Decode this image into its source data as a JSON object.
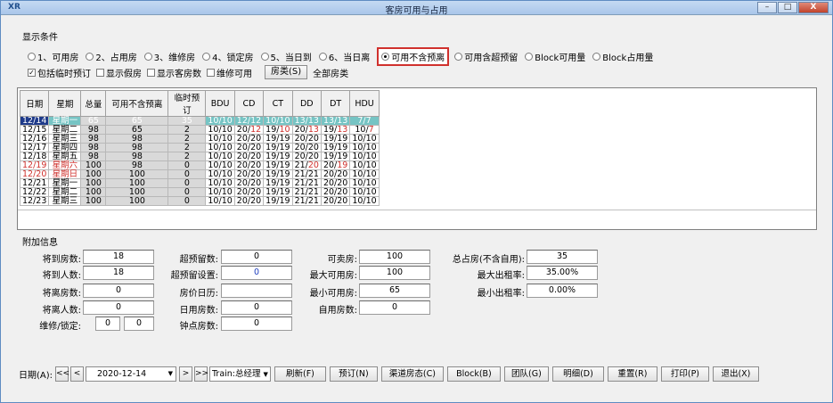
{
  "window": {
    "title": "客房可用与占用",
    "app_icon": "XR",
    "minimize": "–",
    "maximize": "□",
    "close": "X"
  },
  "display": {
    "group_label": "显示条件",
    "radios": [
      {
        "label": "1、可用房",
        "selected": false
      },
      {
        "label": "2、占用房",
        "selected": false
      },
      {
        "label": "3、维修房",
        "selected": false
      },
      {
        "label": "4、锁定房",
        "selected": false
      },
      {
        "label": "5、当日到",
        "selected": false
      },
      {
        "label": "6、当日离",
        "selected": false
      },
      {
        "label": "可用不含预离",
        "selected": true
      },
      {
        "label": "可用含超预留",
        "selected": false
      },
      {
        "label": "Block可用量",
        "selected": false
      },
      {
        "label": "Block占用量",
        "selected": false
      }
    ],
    "checks": [
      {
        "label": "包括临时预订",
        "checked": true
      },
      {
        "label": "显示假房",
        "checked": false
      },
      {
        "label": "显示客房数",
        "checked": false
      },
      {
        "label": "维修可用",
        "checked": false
      }
    ],
    "room_type_button": "房类(S)",
    "room_type_value": "全部房类"
  },
  "grid": {
    "headers": [
      "日期",
      "星期",
      "总量",
      "可用不含预离",
      "临时预订",
      "BDU",
      "CD",
      "CT",
      "DD",
      "DT",
      "HDU"
    ],
    "rows": [
      {
        "date": "12/14",
        "weekday": "星期一",
        "total": "65",
        "avail": "65",
        "temp": "35",
        "bdu": "10/10",
        "cd": "12/12",
        "ct": "10/10",
        "dd": "13/13",
        "dt": "13/13",
        "hdu": "7/7"
      },
      {
        "date": "12/15",
        "weekday": "星期二",
        "total": "98",
        "avail": "65",
        "temp": "2",
        "bdu": "10/10",
        "cd": "20/12",
        "ct": "19/10",
        "dd": "20/13",
        "dt": "19/13",
        "hdu": "10/7"
      },
      {
        "date": "12/16",
        "weekday": "星期三",
        "total": "98",
        "avail": "98",
        "temp": "2",
        "bdu": "10/10",
        "cd": "20/20",
        "ct": "19/19",
        "dd": "20/20",
        "dt": "19/19",
        "hdu": "10/10"
      },
      {
        "date": "12/17",
        "weekday": "星期四",
        "total": "98",
        "avail": "98",
        "temp": "2",
        "bdu": "10/10",
        "cd": "20/20",
        "ct": "19/19",
        "dd": "20/20",
        "dt": "19/19",
        "hdu": "10/10"
      },
      {
        "date": "12/18",
        "weekday": "星期五",
        "total": "98",
        "avail": "98",
        "temp": "2",
        "bdu": "10/10",
        "cd": "20/20",
        "ct": "19/19",
        "dd": "20/20",
        "dt": "19/19",
        "hdu": "10/10"
      },
      {
        "date": "12/19",
        "weekday": "星期六",
        "total": "100",
        "avail": "98",
        "temp": "0",
        "bdu": "10/10",
        "cd": "20/20",
        "ct": "19/19",
        "dd": "21/20",
        "dt": "20/19",
        "hdu": "10/10"
      },
      {
        "date": "12/20",
        "weekday": "星期日",
        "total": "100",
        "avail": "100",
        "temp": "0",
        "bdu": "10/10",
        "cd": "20/20",
        "ct": "19/19",
        "dd": "21/21",
        "dt": "20/20",
        "hdu": "10/10"
      },
      {
        "date": "12/21",
        "weekday": "星期一",
        "total": "100",
        "avail": "100",
        "temp": "0",
        "bdu": "10/10",
        "cd": "20/20",
        "ct": "19/19",
        "dd": "21/21",
        "dt": "20/20",
        "hdu": "10/10"
      },
      {
        "date": "12/22",
        "weekday": "星期二",
        "total": "100",
        "avail": "100",
        "temp": "0",
        "bdu": "10/10",
        "cd": "20/20",
        "ct": "19/19",
        "dd": "21/21",
        "dt": "20/20",
        "hdu": "10/10"
      },
      {
        "date": "12/23",
        "weekday": "星期三",
        "total": "100",
        "avail": "100",
        "temp": "0",
        "bdu": "10/10",
        "cd": "20/20",
        "ct": "19/19",
        "dd": "21/21",
        "dt": "20/20",
        "hdu": "10/10"
      }
    ]
  },
  "info": {
    "title": "附加信息",
    "arr_rooms_label": "将到房数:",
    "arr_rooms": "18",
    "arr_people_label": "将到人数:",
    "arr_people": "18",
    "dep_rooms_label": "将离房数:",
    "dep_rooms": "0",
    "dep_people_label": "将离人数:",
    "dep_people": "0",
    "maint_lock_label": "维修/锁定:",
    "maint": "0",
    "lock": "0",
    "over_reserve_label": "超预留数:",
    "over_reserve": "0",
    "over_setting_label": "超预留设置:",
    "over_setting": "0",
    "price_calendar_label": "房价日历:",
    "price_calendar": "",
    "day_use_label": "日用房数:",
    "day_use": "0",
    "hourly_label": "钟点房数:",
    "hourly": "0",
    "sellable_label": "可卖房:",
    "sellable": "100",
    "max_avail_label": "最大可用房:",
    "max_avail": "100",
    "min_avail_label": "最小可用房:",
    "min_avail": "65",
    "self_use_label": "自用房数:",
    "self_use": "0",
    "total_occ_label": "总占房(不含自用):",
    "total_occ": "35",
    "max_rate_label": "最大出租率:",
    "max_rate": "35.00%",
    "min_rate_label": "最小出租率:",
    "min_rate": "0.00%"
  },
  "bottom": {
    "date_label": "日期(A):",
    "date_value": "2020-12-14",
    "operator": "Train:总经理",
    "buttons": [
      "刷新(F)",
      "预订(N)",
      "渠道房态(C)",
      "Block(B)",
      "团队(G)",
      "明细(D)",
      "重置(R)",
      "打印(P)",
      "退出(X)"
    ]
  }
}
